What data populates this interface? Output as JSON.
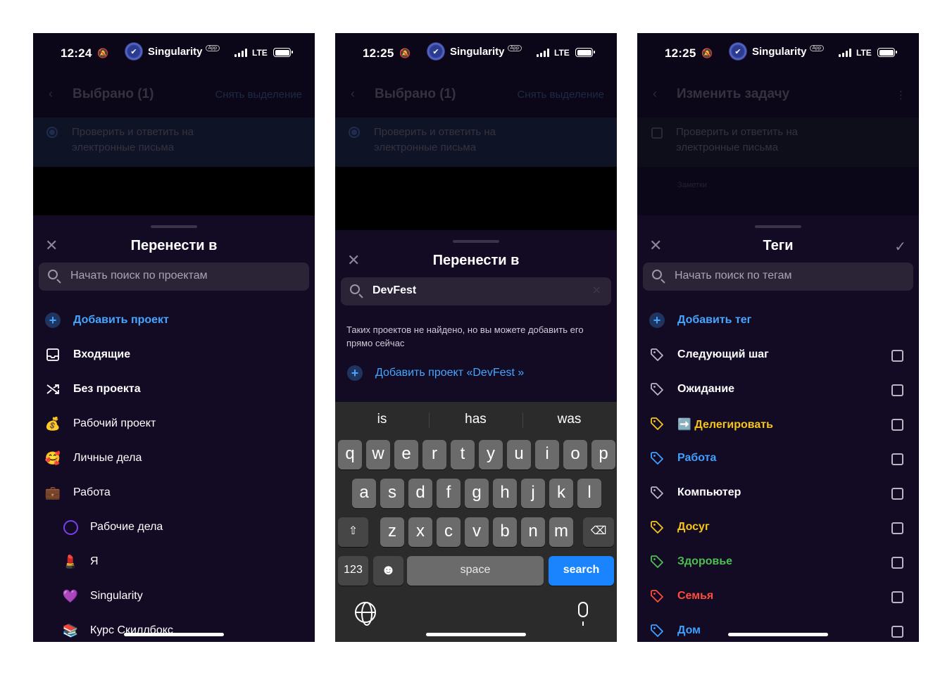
{
  "status_bar": [
    {
      "time": "12:24",
      "app": "Singularity",
      "badge": "App",
      "network": "LTE"
    },
    {
      "time": "12:25",
      "app": "Singularity",
      "badge": "App",
      "network": "LTE"
    },
    {
      "time": "12:25",
      "app": "Singularity",
      "badge": "App",
      "network": "LTE"
    }
  ],
  "background": {
    "selected_title": "Выбрано (1)",
    "deselect": "Снять выделение",
    "edit_title": "Изменить задачу",
    "task": "Проверить и ответить на электронные письма",
    "note": "Заметки"
  },
  "screen1": {
    "title": "Перенести в",
    "search_placeholder": "Начать поиск по проектам",
    "items": [
      {
        "label": "Добавить проект",
        "icon": "plus-icon"
      },
      {
        "label": "Входящие",
        "icon": "inbox-icon"
      },
      {
        "label": "Без проекта",
        "icon": "shuffle-icon"
      },
      {
        "label": "Рабочий проект",
        "icon": "money-bag-emoji",
        "glyph": "💰"
      },
      {
        "label": "Личные дела",
        "icon": "smiling-hearts-emoji",
        "glyph": "🥰"
      },
      {
        "label": "Работа",
        "icon": "briefcase-emoji",
        "glyph": "💼"
      },
      {
        "label": "Рабочие дела",
        "icon": "circle-icon"
      },
      {
        "label": "Я",
        "icon": "lipstick-emoji",
        "glyph": "💄"
      },
      {
        "label": "Singularity",
        "icon": "purple-heart-emoji",
        "glyph": "💜"
      },
      {
        "label": "Курс Скиллбокс",
        "icon": "books-emoji",
        "glyph": "📚"
      }
    ]
  },
  "screen2": {
    "title": "Перенести в",
    "search_value": "DevFest",
    "empty_message": "Таких проектов не найдено, но вы можете добавить его прямо сейчас",
    "add_label": "Добавить проект «DevFest »",
    "suggestions": [
      "is",
      "has",
      "was"
    ],
    "rows": [
      [
        "q",
        "w",
        "e",
        "r",
        "t",
        "y",
        "u",
        "i",
        "o",
        "p"
      ],
      [
        "a",
        "s",
        "d",
        "f",
        "g",
        "h",
        "j",
        "k",
        "l"
      ],
      [
        "z",
        "x",
        "c",
        "v",
        "b",
        "n",
        "m"
      ]
    ],
    "key_numbers": "123",
    "key_space": "space",
    "key_search": "search"
  },
  "screen3": {
    "title": "Теги",
    "search_placeholder": "Начать поиск по тегам",
    "add_label": "Добавить тег",
    "tags": [
      {
        "label": "Следующий шаг",
        "color": "#ffffff",
        "tag_color": "#b9b5c3"
      },
      {
        "label": "Ожидание",
        "color": "#ffffff",
        "tag_color": "#b9b5c3"
      },
      {
        "label": "➡️ Делегировать",
        "color": "#f5c518",
        "tag_color": "#f5c518"
      },
      {
        "label": "Работа",
        "color": "#3ea0ff",
        "tag_color": "#3ea0ff"
      },
      {
        "label": "Компьютер",
        "color": "#ffffff",
        "tag_color": "#b9b5c3"
      },
      {
        "label": "Досуг",
        "color": "#f5c518",
        "tag_color": "#f5c518"
      },
      {
        "label": "Здоровье",
        "color": "#4cc04f",
        "tag_color": "#4cc04f"
      },
      {
        "label": "Семья",
        "color": "#ff4d3a",
        "tag_color": "#ff4d3a"
      },
      {
        "label": "Дом",
        "color": "#3ea0ff",
        "tag_color": "#3ea0ff"
      }
    ]
  },
  "colors": {
    "accent": "#44a6ff",
    "sheet": "#130a24",
    "keyboard": "#2b2b2b",
    "search_key": "#1a84ff"
  }
}
